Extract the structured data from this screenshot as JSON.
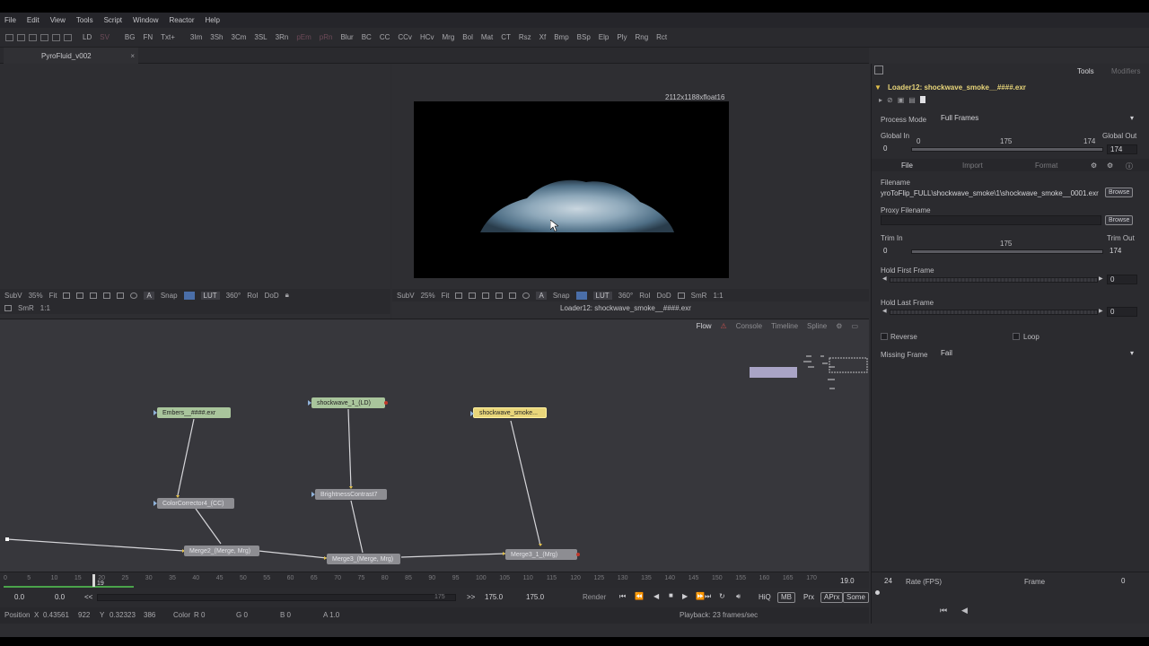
{
  "menu": [
    "File",
    "Edit",
    "View",
    "Tools",
    "Script",
    "Window",
    "Reactor",
    "Help"
  ],
  "toolbar": {
    "tools": [
      "LD",
      "SV",
      "BG",
      "FN",
      "Txt+",
      "3Im",
      "3Sh",
      "3Cm",
      "3SL",
      "3Rn",
      "pEm",
      "pRn",
      "Blur",
      "BC",
      "CC",
      "CCv",
      "HCv",
      "Mrg",
      "Bol",
      "Mat",
      "CT",
      "Rsz",
      "Xf",
      "Bmp",
      "BSp",
      "Elp",
      "Ply",
      "Rng",
      "Rct"
    ]
  },
  "tab": {
    "label": "PyroFluid_v002",
    "close": "×"
  },
  "viewer_left": {
    "toolbar": {
      "subv": "SubV",
      "zoom": "35%",
      "fit": "Fit",
      "snap": "Snap",
      "lut": "LUT",
      "deg": "360°",
      "roi": "RoI",
      "dod": "DoD",
      "smr": "SmR",
      "ratio": "1:1"
    }
  },
  "viewer_right": {
    "resolution": "2112x1188xfloat16",
    "toolbar": {
      "subv": "SubV",
      "zoom": "25%",
      "fit": "Fit",
      "snap": "Snap",
      "lut": "LUT",
      "deg": "360°",
      "roi": "RoI",
      "dod": "DoD",
      "smr": "SmR",
      "ratio": "1:1"
    },
    "filename": "Loader12: shockwave_smoke__####.exr"
  },
  "flow": {
    "tabs": [
      "Flow",
      "Console",
      "Timeline",
      "Spline"
    ],
    "nodes": {
      "embers": "Embers__####.exr",
      "shockwave1": "shockwave_1_(LD)",
      "shockwave_smoke": "shockwave_smoke...",
      "colorcorrector": "ColorCorrector4_(CC)",
      "brightness": "BrightnessContrast7",
      "merge2": "Merge2_(Merge, Mrg)",
      "merge3": "Merge3_(Merge, Mrg)",
      "merge3_1": "Merge3_1_(Mrg)"
    }
  },
  "ruler": {
    "ticks": [
      "0",
      "5",
      "10",
      "15",
      "20",
      "25",
      "30",
      "35",
      "40",
      "45",
      "50",
      "55",
      "60",
      "65",
      "70",
      "75",
      "80",
      "85",
      "90",
      "95",
      "100",
      "105",
      "110",
      "115",
      "120",
      "125",
      "130",
      "135",
      "140",
      "145",
      "150",
      "155",
      "160",
      "165",
      "170"
    ],
    "current": "19",
    "end_value": "19.0"
  },
  "transport": {
    "start": "0.0",
    "render_start": "0.0",
    "back": "<<",
    "range_end": "175",
    "fwd": ">>",
    "render_end": "175.0",
    "end": "175.0",
    "render_label": "Render",
    "hiq": "HiQ",
    "mb": "MB",
    "prx": "Prx",
    "aprx": "APrx",
    "some": "Some"
  },
  "status": {
    "position_label": "Position",
    "x_label": "X",
    "x_val": "0.43561",
    "x_px": "922",
    "y_label": "Y",
    "y_val": "0.32323",
    "y_px": "386",
    "color_label": "Color",
    "r": "R 0",
    "g": "G 0",
    "b": "B 0",
    "a": "A 1.0",
    "playback": "Playback: 23 frames/sec"
  },
  "inspector": {
    "tabs": {
      "tools": "Tools",
      "modifiers": "Modifiers"
    },
    "title": "Loader12: shockwave_smoke__####.exr",
    "process_mode_label": "Process Mode",
    "process_mode_value": "Full Frames",
    "global_in_label": "Global In",
    "global_out_label": "Global Out",
    "global_in_value": "0",
    "global_slider_start": "0",
    "global_slider_mid": "175",
    "global_slider_end": "174",
    "global_out_value": "174",
    "subtabs": [
      "File",
      "Import",
      "Format"
    ],
    "filename_label": "Filename",
    "filename_value": "yroToFlip_FULL\\shockwave_smoke\\1\\shockwave_smoke__0001.exr",
    "browse": "Browse",
    "proxy_label": "Proxy Filename",
    "trim_in_label": "Trim In",
    "trim_out_label": "Trim Out",
    "trim_in_value": "0",
    "trim_mid": "175",
    "trim_out_value": "174",
    "hold_first_label": "Hold First Frame",
    "hold_first_value": "0",
    "hold_last_label": "Hold Last Frame",
    "hold_last_value": "0",
    "reverse_label": "Reverse",
    "loop_label": "Loop",
    "missing_frame_label": "Missing Frame",
    "missing_frame_value": "Fail",
    "footer": {
      "fps_value": "24",
      "fps_label": "Rate (FPS)",
      "frame_label": "Frame",
      "frame_value": "0"
    }
  },
  "colors": {
    "selected_node": "#e9d67a",
    "loader_node": "#a9c59c",
    "accent_blue": "#4a6ea8",
    "timeline_green": "#4aa34a"
  }
}
